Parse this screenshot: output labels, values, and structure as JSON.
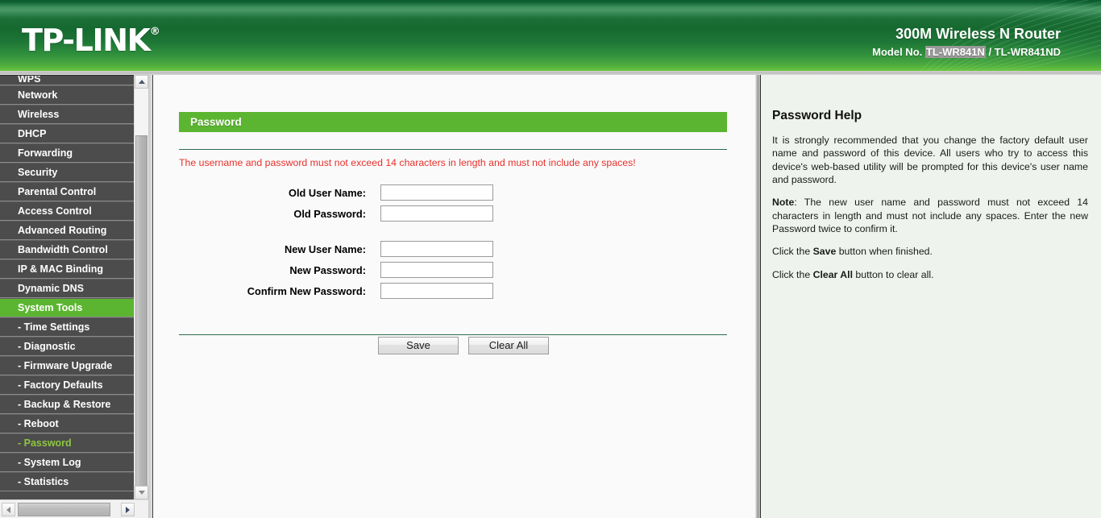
{
  "header": {
    "logo": "TP-LINK",
    "logo_reg": "®",
    "product_title": "300M Wireless N Router",
    "model_prefix": "Model No.",
    "model_selected": "TL-WR841N",
    "model_rest": " / TL-WR841ND"
  },
  "sidebar": {
    "items": [
      {
        "label": "WPS",
        "state": "clipped"
      },
      {
        "label": "Network",
        "state": "normal"
      },
      {
        "label": "Wireless",
        "state": "normal"
      },
      {
        "label": "DHCP",
        "state": "normal"
      },
      {
        "label": "Forwarding",
        "state": "normal"
      },
      {
        "label": "Security",
        "state": "normal"
      },
      {
        "label": "Parental Control",
        "state": "normal"
      },
      {
        "label": "Access Control",
        "state": "normal"
      },
      {
        "label": "Advanced Routing",
        "state": "normal"
      },
      {
        "label": "Bandwidth Control",
        "state": "normal"
      },
      {
        "label": "IP & MAC Binding",
        "state": "normal"
      },
      {
        "label": "Dynamic DNS",
        "state": "normal"
      },
      {
        "label": "System Tools",
        "state": "active-parent"
      },
      {
        "label": "- Time Settings",
        "state": "sub"
      },
      {
        "label": "- Diagnostic",
        "state": "sub"
      },
      {
        "label": "- Firmware Upgrade",
        "state": "sub"
      },
      {
        "label": "- Factory Defaults",
        "state": "sub"
      },
      {
        "label": "- Backup & Restore",
        "state": "sub"
      },
      {
        "label": "- Reboot",
        "state": "sub"
      },
      {
        "label": "- Password",
        "state": "active-sub"
      },
      {
        "label": "- System Log",
        "state": "sub"
      },
      {
        "label": "- Statistics",
        "state": "sub"
      }
    ]
  },
  "main": {
    "page_title": "Password",
    "warning": "The username and password must not exceed 14 characters in length and must not include any spaces!",
    "fields": [
      {
        "label": "Old User Name:",
        "value": "",
        "type": "text"
      },
      {
        "label": "Old Password:",
        "value": "",
        "type": "password"
      },
      {
        "label": "New User Name:",
        "value": "",
        "type": "text"
      },
      {
        "label": "New Password:",
        "value": "",
        "type": "password"
      },
      {
        "label": "Confirm New Password:",
        "value": "",
        "type": "password"
      }
    ],
    "buttons": {
      "save": "Save",
      "clear_all": "Clear All"
    }
  },
  "help": {
    "title": "Password Help",
    "paragraph_1": "It is strongly recommended that you change the factory default user name and password of this device. All users who try to access this device's web-based utility will be prompted for this device's user name and password.",
    "note_label": "Note",
    "note_body": ": The new user name and password must not exceed 14 characters in length and must not include any spaces. Enter the new Password twice to confirm it.",
    "save_line_pre": "Click the ",
    "save_line_bold": "Save",
    "save_line_post": " button when finished.",
    "clear_line_pre": "Click the ",
    "clear_line_bold": "Clear All",
    "clear_line_post": " button to clear all."
  },
  "colors": {
    "brand_green": "#5cb531",
    "header_dark_green": "#0c5a2c",
    "warning_red": "#e8302a",
    "active_sub_green": "#8dc63f",
    "sidebar_bg": "#4c4c4c",
    "help_bg": "#eef4ed"
  }
}
